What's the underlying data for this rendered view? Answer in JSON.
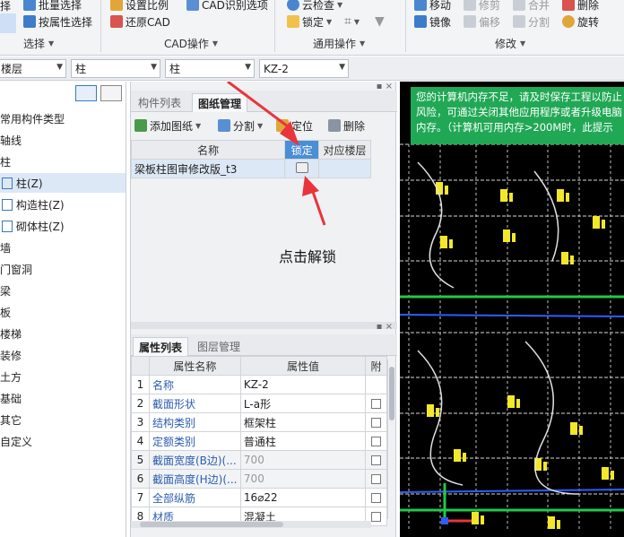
{
  "ribbon": {
    "select": {
      "row1": "批量选择",
      "row1_prefix": "择",
      "row2": "按属性选择",
      "group": "选择"
    },
    "cad_ops": {
      "row1a": "设置比例",
      "row1b": "CAD识别选项",
      "row2": "还原CAD",
      "group": "CAD操作"
    },
    "common_ops": {
      "row1": "云检查",
      "row2": "锁定",
      "group": "通用操作"
    },
    "modify": {
      "row1a": "移动",
      "row1b": "修剪",
      "row1c": "合并",
      "row1d": "删除",
      "row2a": "镜像",
      "row2b": "偏移",
      "row2c": "分割",
      "row2d": "旋转",
      "group": "修改"
    },
    "accent_color": "#2f6fc2"
  },
  "selectors": {
    "floor": "楼层",
    "category": "柱",
    "type": "柱",
    "element": "KZ-2"
  },
  "tree": {
    "items": [
      {
        "label": "常用构件类型"
      },
      {
        "label": "轴线"
      },
      {
        "label": "柱"
      },
      {
        "label": "柱(Z)"
      },
      {
        "label": "构造柱(Z)"
      },
      {
        "label": "砌体柱(Z)"
      },
      {
        "label": "墙"
      },
      {
        "label": "门窗洞"
      },
      {
        "label": "梁"
      },
      {
        "label": "板"
      },
      {
        "label": "楼梯"
      },
      {
        "label": "装修"
      },
      {
        "label": "土方"
      },
      {
        "label": "基础"
      },
      {
        "label": "其它"
      },
      {
        "label": "自定义"
      }
    ]
  },
  "drawing_panel": {
    "tab1": "构件列表",
    "tab2": "图纸管理",
    "add": "添加图纸",
    "split": "分割",
    "locate": "定位",
    "delete": "删除",
    "col_name": "名称",
    "col_lock": "锁定",
    "col_floor": "对应楼层",
    "row_name": "梁板柱图审修改版_t3",
    "annotation": "点击解锁"
  },
  "props_panel": {
    "tab1": "属性列表",
    "tab2": "图层管理",
    "col_prop": "属性名称",
    "col_value": "属性值",
    "col_extra": "附",
    "rows": [
      {
        "no": "1",
        "name": "名称",
        "value": "KZ-2"
      },
      {
        "no": "2",
        "name": "截面形状",
        "value": "L-a形"
      },
      {
        "no": "3",
        "name": "结构类别",
        "value": "框架柱"
      },
      {
        "no": "4",
        "name": "定额类别",
        "value": "普通柱"
      },
      {
        "no": "5",
        "name": "截面宽度(B边)(...",
        "value": "700"
      },
      {
        "no": "6",
        "name": "截面高度(H边)(...",
        "value": "700"
      },
      {
        "no": "7",
        "name": "全部纵筋",
        "value": "16⌀22"
      },
      {
        "no": "8",
        "name": "材质",
        "value": "混凝土"
      }
    ]
  },
  "canvas": {
    "warning_line1": "您的计算机内存不足，请及时保存工程以防止",
    "warning_line2": "风险，可通过关闭其他应用程序或者升级电脑",
    "warning_line3": "内存。（计算机可用内存>200M时，此提示",
    "warning_color": "#21a855"
  }
}
